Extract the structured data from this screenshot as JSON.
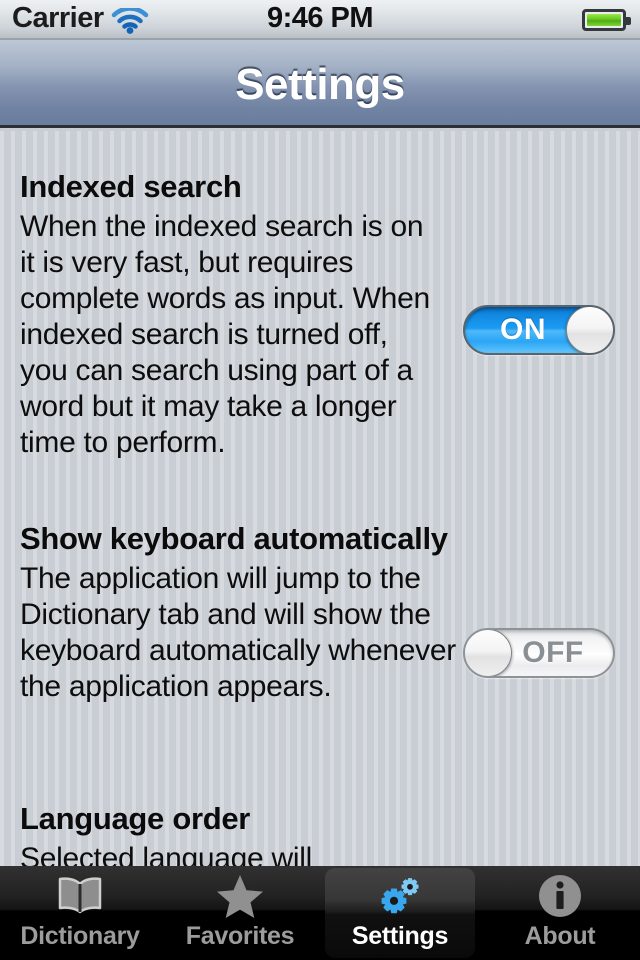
{
  "status_bar": {
    "carrier": "Carrier",
    "time": "9:46 PM",
    "wifi_icon": "wifi-icon",
    "battery_icon": "battery-full-icon"
  },
  "nav_bar": {
    "title": "Settings"
  },
  "sections": [
    {
      "id": "indexed-search",
      "heading": "Indexed search",
      "body": "When the indexed search is on it is very fast, but requires complete words as input. When indexed search is turned off, you can search using part of a word but it may take a longer time to perform.",
      "switch": {
        "state": "ON",
        "label": "ON"
      }
    },
    {
      "id": "show-keyboard",
      "heading": "Show keyboard automatically",
      "body": "The application will jump to the Dictionary tab and will show the keyboard automatically whenever the application appears.",
      "switch": {
        "state": "OFF",
        "label": "OFF"
      }
    },
    {
      "id": "language-order",
      "heading": "Language order",
      "body": "Selected language will"
    }
  ],
  "tab_bar": {
    "tabs": [
      {
        "label": "Dictionary",
        "icon": "book-icon",
        "active": false
      },
      {
        "label": "Favorites",
        "icon": "star-icon",
        "active": false
      },
      {
        "label": "Settings",
        "icon": "gears-icon",
        "active": true
      },
      {
        "label": "About",
        "icon": "info-circle-icon",
        "active": false
      }
    ]
  },
  "colors": {
    "switch_on_blue": "#1b9bf2",
    "accent_gear_blue": "#3aa2e8",
    "content_background": "#c9ced5",
    "nav_bar_top": "#bcc7d6",
    "nav_bar_bottom": "#6b7d9e",
    "battery_green": "#63c81e",
    "tab_active_label": "#ffffff",
    "tab_inactive_label": "#9c9c9c"
  }
}
